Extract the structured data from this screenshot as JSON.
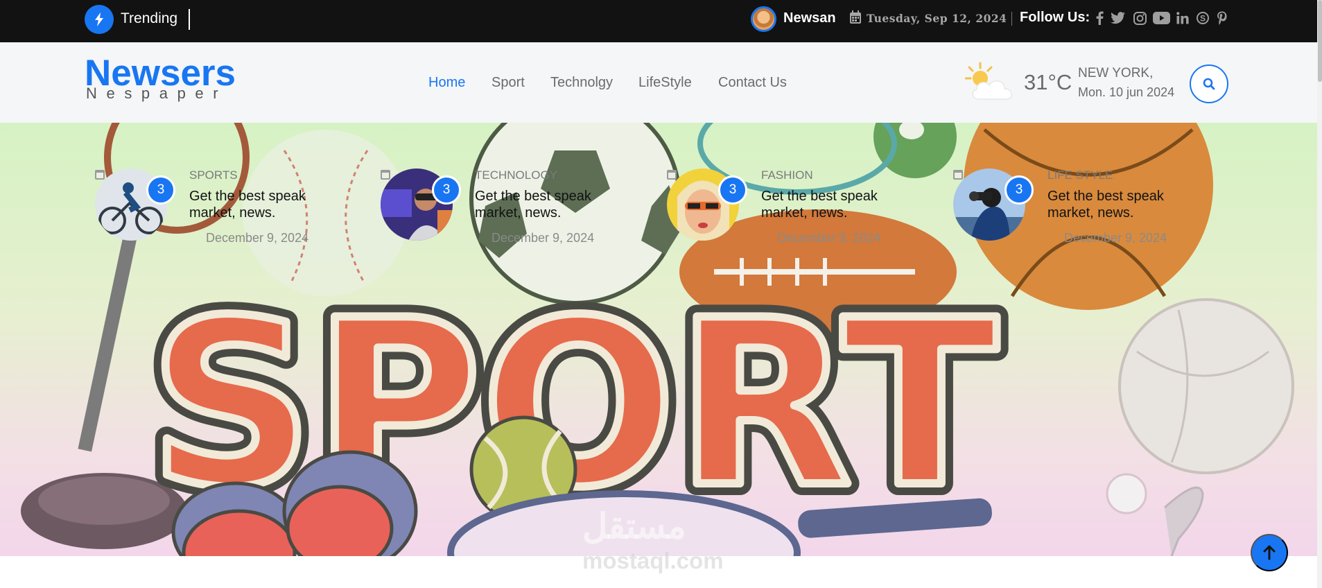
{
  "colors": {
    "accent": "#1976f2",
    "topbar_bg": "#121212",
    "header_bg": "#f4f6f8"
  },
  "topbar": {
    "trending_label": "Trending",
    "user_name": "Newsan",
    "date": "Tuesday, Sep 12, 2024",
    "follow_label": "Follow Us:",
    "social_icons": [
      "facebook-icon",
      "twitter-icon",
      "instagram-icon",
      "youtube-icon",
      "linkedin-icon",
      "skype-icon",
      "pinterest-icon"
    ]
  },
  "header": {
    "logo_title": "Newsers",
    "logo_subtitle": "Nespaper",
    "nav": [
      "Home",
      "Sport",
      "Technolgy",
      "LifeStyle",
      "Contact Us"
    ],
    "active_nav": "Home",
    "weather": {
      "temperature": "31°C",
      "city": "NEW YORK,",
      "date": "Mon. 10 jun 2024"
    }
  },
  "hero": {
    "banner_word": "SPORT",
    "watermark_top": "مستقل",
    "watermark_bottom": "mostaql.com"
  },
  "news": [
    {
      "category": "SPORTS",
      "title": "Get the best speak market, news.",
      "date": "December 9, 2024",
      "badge": "3"
    },
    {
      "category": "TECHNOLOGY",
      "title": "Get the best speak market, news.",
      "date": "December 9, 2024",
      "badge": "3"
    },
    {
      "category": "FASHION",
      "title": "Get the best speak market, news.",
      "date": "December 9, 2024",
      "badge": "3"
    },
    {
      "category": "LIFE STYLE",
      "title": "Get the best speak market, news.",
      "date": "December 9, 2024",
      "badge": "3"
    }
  ]
}
